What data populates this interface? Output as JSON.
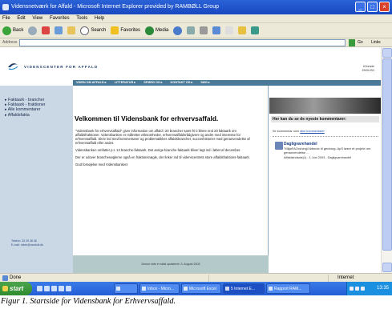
{
  "window": {
    "title": "Vidensnetværk for Affald - Microsoft Internet Explorer provided by RAMBØLL Group",
    "controls": [
      "_",
      "□",
      "×"
    ]
  },
  "menu": [
    "File",
    "Edit",
    "View",
    "Favorites",
    "Tools",
    "Help"
  ],
  "toolbar": {
    "back": "Back",
    "search": "Search",
    "favorites": "Favorites",
    "media": "Media"
  },
  "address": {
    "label": "Address",
    "go": "Go",
    "links": "Links"
  },
  "site": {
    "logo_text": "VIDENSCENTER FOR AFFALD",
    "header_links": [
      "til forside",
      "ENGLISH"
    ],
    "nav": [
      "VIDEN OM AFFALD ▸",
      "LITTERATUR ▸",
      "SPØRG OS ▸",
      "KONTAKT OS ▸",
      "SØG ▸"
    ],
    "sidebar": {
      "items": [
        "▸ Faktaark - brancher",
        "▸ Faktaark - fraktioner",
        "▸ Alle kommentarer",
        "▸ Affaldsfakta"
      ],
      "footer_phone": "Telefon: 33 25 38 36",
      "footer_email": "E-mail: viden@ramboll.dk"
    },
    "main": {
      "title": "Velkommen til Vidensbank for erhvervsaffald.",
      "paragraphs": [
        "\"Vidensbank for erhvervsaffald\" giver information om affald i 20 brancher samt fri ti ltlmre end 20 faktaark om affaldsfraktioner. Vidensbanken er målrettet virksomheder, erhvervsaffaldsrådgivere og andre med interesse for erhvervsaffald. Skriv ind med kommentarer og problematikker affaldsbrancher, succeshistorier med genanvendelse af erhvervsaffald eller andet.",
        "Vidensbanken omfatter p.t. 13 branche-faktaark. Det øvrige branche-faktaark bliver lagt ind i løbet af december.",
        "Der er udover branchenøglerne også en fraktionsnøgle, der linker ind til videnscentrets store affaldsfraktions-faktaark.",
        "God fornøjelse med Vidensbanken!"
      ],
      "footer": "Denne side er sidst opdateret: 3. August 2003"
    },
    "right": {
      "title": "Her kan du se de nyeste kommentarer:",
      "subtitle_prefix": "Se kommentar over",
      "subtitle_link": "dine kommentarer",
      "item_head": "Dagligvarehandel",
      "item_body": "\"MiljøFAOrdning/Vidende til genbrug: ApS løser et projekt om genanvendelse ...",
      "item_date": "Affaldsindsats(1) - 1.Juni 2003 - Dagligvarehandel"
    }
  },
  "status": {
    "text": "Done",
    "zone": "Internet"
  },
  "taskbar": {
    "start": "start",
    "tasks": [
      "",
      "Inbox - Micro...",
      "Microsoft Excel",
      "5 Internet E...",
      "Rapport RAM..."
    ],
    "active_index": 3,
    "clock": "13:35"
  },
  "caption": "Figur 1. Startside for Vidensbank for Erhvervsaffald.",
  "colors": {
    "title_bar": "#2a62d8",
    "nav_bar": "#4a7a98",
    "sidebar_bg": "#cad8e6",
    "content_footer": "#b4c9c9",
    "taskbar": "#245ed6",
    "start_button": "#2f8a2f"
  }
}
